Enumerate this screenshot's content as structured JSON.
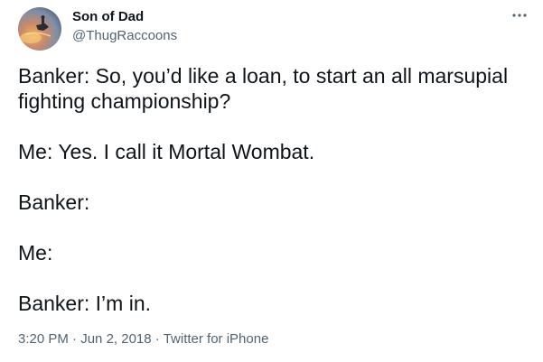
{
  "author": {
    "display_name": "Son of Dad",
    "handle": "@ThugRaccoons"
  },
  "icons": {
    "more": "more-horizontal-icon"
  },
  "tweet": {
    "lines": [
      "Banker: So, you’d like a loan, to start an all marsupial fighting championship?",
      "Me:  Yes. I call it Mortal Wombat.",
      "Banker:",
      "Me:",
      "Banker: I’m in."
    ]
  },
  "meta": {
    "time": "3:20 PM",
    "date": "Jun 2, 2018",
    "source": "Twitter for iPhone",
    "separator": "·"
  },
  "colors": {
    "text_primary": "#0f1419",
    "text_secondary": "#536471"
  }
}
